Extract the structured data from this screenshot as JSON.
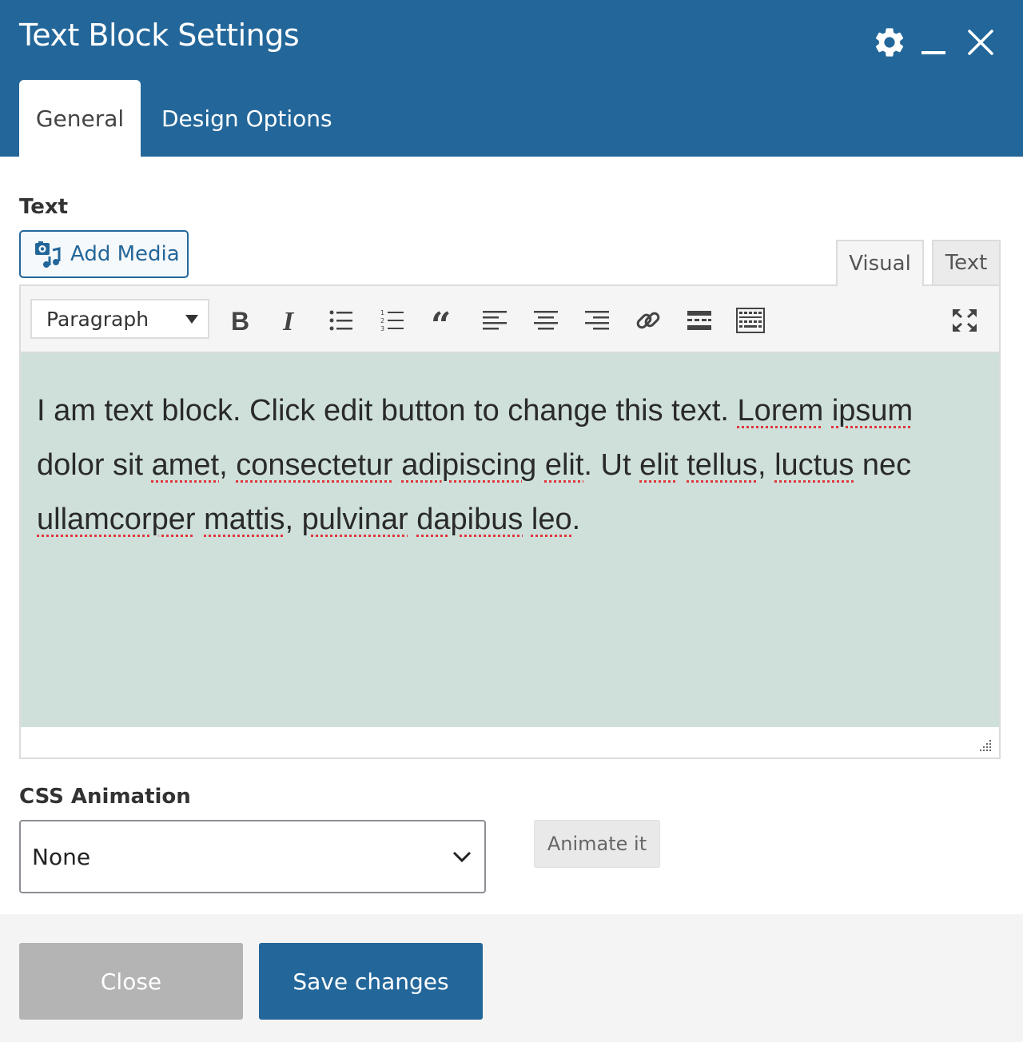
{
  "dialog": {
    "title": "Text Block Settings",
    "header_icons": [
      "gear-icon",
      "minimize-icon",
      "close-icon"
    ],
    "tabs": [
      {
        "label": "General",
        "active": true
      },
      {
        "label": "Design Options",
        "active": false
      }
    ]
  },
  "text_field": {
    "label": "Text",
    "add_media_label": "Add Media",
    "modes": [
      {
        "label": "Visual",
        "active": true
      },
      {
        "label": "Text",
        "active": false
      }
    ],
    "toolbar": {
      "format_value": "Paragraph",
      "buttons": [
        "bold-icon",
        "italic-icon",
        "bullet-list-icon",
        "numbered-list-icon",
        "blockquote-icon",
        "align-left-icon",
        "align-center-icon",
        "align-right-icon",
        "link-icon",
        "read-more-icon",
        "toolbar-toggle-icon",
        "fullscreen-icon"
      ]
    },
    "content": {
      "segments": [
        "I am text block. Click edit button to change this text. ",
        "Lorem",
        " ",
        "ipsum",
        " dolor sit ",
        "amet",
        ", ",
        "consectetur",
        " ",
        "adipiscing",
        " ",
        "elit",
        ". Ut ",
        "elit",
        " ",
        "tellus",
        ", ",
        "luctus",
        " nec ",
        "ullamcorper",
        " ",
        "mattis",
        ", ",
        "pulvinar",
        " ",
        "dapibus",
        " ",
        "leo",
        "."
      ]
    }
  },
  "css_animation": {
    "label": "CSS Animation",
    "selected": "None",
    "animate_label": "Animate it"
  },
  "footer": {
    "close_label": "Close",
    "save_label": "Save changes"
  },
  "colors": {
    "header": "#23679a",
    "editor_bg": "#cfe0db",
    "close_btn": "#b4b4b4",
    "save_btn": "#23679a"
  }
}
